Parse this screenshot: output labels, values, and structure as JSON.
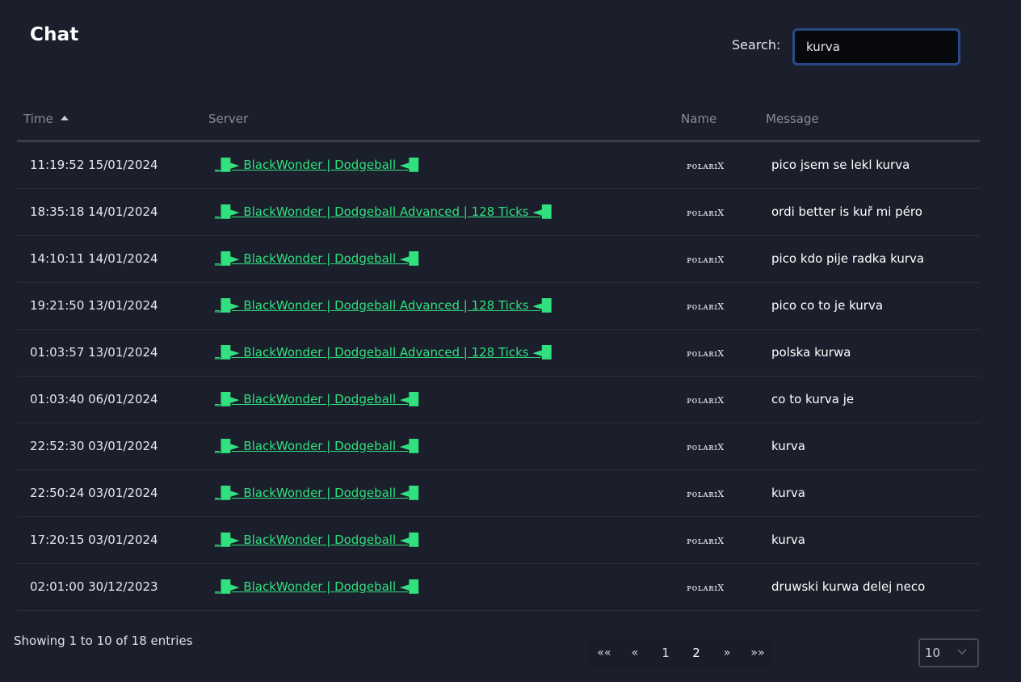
{
  "header": {
    "title": "Chat",
    "search_label": "Search:",
    "search_value": "kurva"
  },
  "table": {
    "columns": [
      "Time",
      "Server",
      "Name",
      "Message"
    ],
    "sort": {
      "column": "Time",
      "direction": "ascending"
    },
    "rows": [
      {
        "time": "11:19:52 15/01/2024",
        "server": "_█► BlackWonder | Dodgeball ◄█",
        "name": "ᴘᴏʟᴀʀɪX",
        "message": "pico jsem se lekl kurva"
      },
      {
        "time": "18:35:18 14/01/2024",
        "server": "_█► BlackWonder | Dodgeball Advanced | 128 Ticks ◄█",
        "name": "ᴘᴏʟᴀʀɪX",
        "message": "ordi better is kuř mi péro"
      },
      {
        "time": "14:10:11 14/01/2024",
        "server": "_█► BlackWonder | Dodgeball ◄█",
        "name": "ᴘᴏʟᴀʀɪX",
        "message": "pico kdo pije radka kurva"
      },
      {
        "time": "19:21:50 13/01/2024",
        "server": "_█► BlackWonder | Dodgeball Advanced | 128 Ticks ◄█",
        "name": "ᴘᴏʟᴀʀɪX",
        "message": "pico co to je kurva"
      },
      {
        "time": "01:03:57 13/01/2024",
        "server": "_█► BlackWonder | Dodgeball Advanced | 128 Ticks ◄█",
        "name": "ᴘᴏʟᴀʀɪX",
        "message": "polska kurwa"
      },
      {
        "time": "01:03:40 06/01/2024",
        "server": "_█► BlackWonder | Dodgeball ◄█",
        "name": "ᴘᴏʟᴀʀɪX",
        "message": "co to kurva je"
      },
      {
        "time": "22:52:30 03/01/2024",
        "server": "_█► BlackWonder | Dodgeball ◄█",
        "name": "ᴘᴏʟᴀʀɪX",
        "message": "kurva"
      },
      {
        "time": "22:50:24 03/01/2024",
        "server": "_█► BlackWonder | Dodgeball ◄█",
        "name": "ᴘᴏʟᴀʀɪX",
        "message": "kurva"
      },
      {
        "time": "17:20:15 03/01/2024",
        "server": "_█► BlackWonder | Dodgeball ◄█",
        "name": "ᴘᴏʟᴀʀɪX",
        "message": "kurva"
      },
      {
        "time": "02:01:00 30/12/2023",
        "server": "_█► BlackWonder | Dodgeball ◄█",
        "name": "ᴘᴏʟᴀʀɪX",
        "message": "druwski kurwa delej neco"
      }
    ]
  },
  "footer": {
    "info": "Showing 1 to 10 of 18 entries",
    "pagination": {
      "first": "««",
      "prev": "«",
      "pages": [
        "1",
        "2"
      ],
      "current": "2",
      "next": "»",
      "last": "»»"
    },
    "page_length": "10",
    "page_length_icon": "chevron-down-icon"
  },
  "colors": {
    "background": "#1b1e2b",
    "server_link": "#31e07f",
    "search_border": "#2a4a86"
  }
}
